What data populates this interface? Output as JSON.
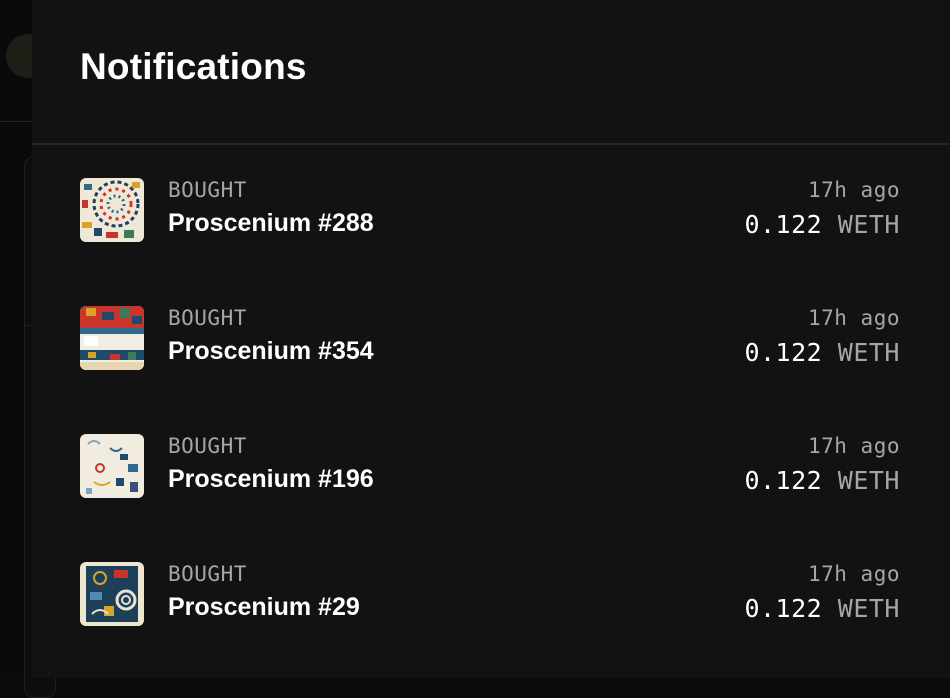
{
  "panel": {
    "title": "Notifications"
  },
  "notifications": [
    {
      "kind": "BOUGHT",
      "name": "Proscenium #288",
      "time": "17h ago",
      "amount": "0.122",
      "currency": "WETH",
      "thumbnail_icon": "artwork-thumbnail"
    },
    {
      "kind": "BOUGHT",
      "name": "Proscenium #354",
      "time": "17h ago",
      "amount": "0.122",
      "currency": "WETH",
      "thumbnail_icon": "artwork-thumbnail"
    },
    {
      "kind": "BOUGHT",
      "name": "Proscenium #196",
      "time": "17h ago",
      "amount": "0.122",
      "currency": "WETH",
      "thumbnail_icon": "artwork-thumbnail"
    },
    {
      "kind": "BOUGHT",
      "name": "Proscenium #29",
      "time": "17h ago",
      "amount": "0.122",
      "currency": "WETH",
      "thumbnail_icon": "artwork-thumbnail"
    }
  ],
  "colors": {
    "panel_bg": "#121212",
    "text_primary": "#ffffff",
    "text_secondary": "#a6a6a6"
  }
}
